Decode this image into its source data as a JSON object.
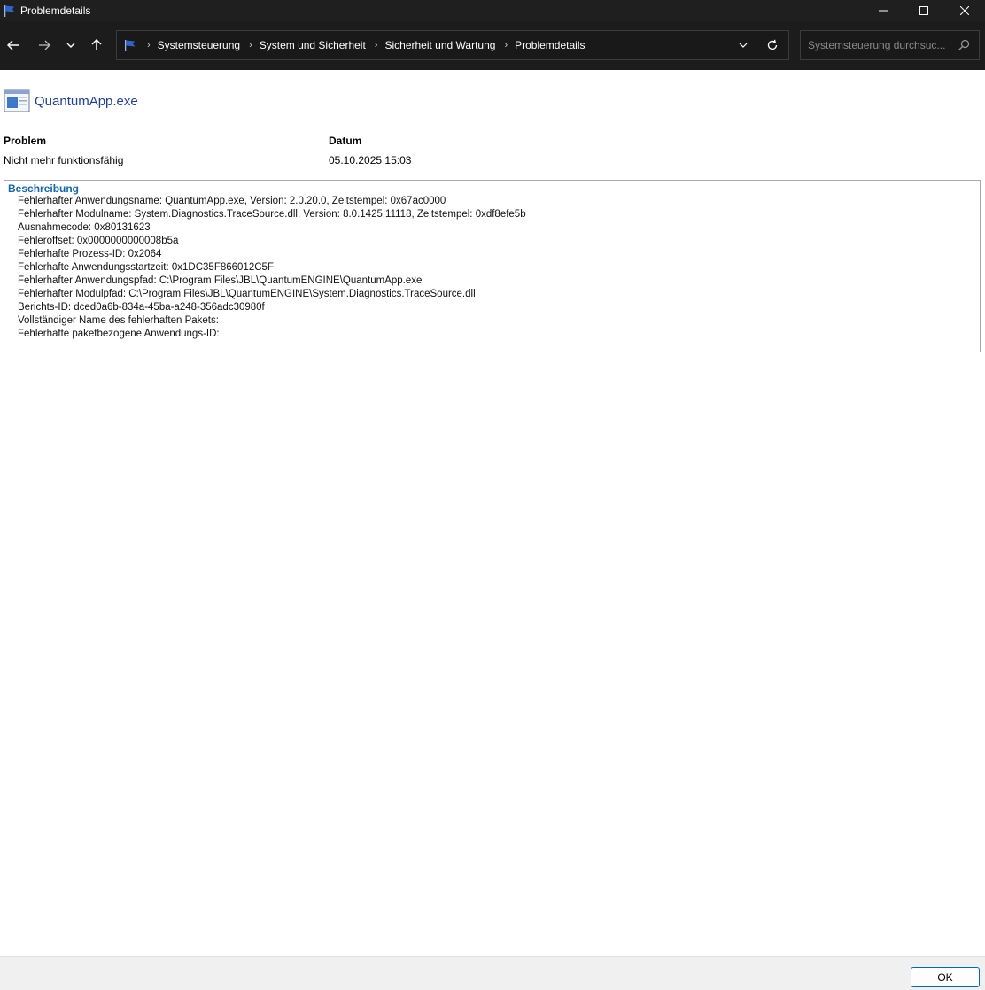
{
  "window": {
    "title": "Problemdetails"
  },
  "nav": {
    "breadcrumbs": [
      {
        "label": "Systemsteuerung"
      },
      {
        "label": "System und Sicherheit"
      },
      {
        "label": "Sicherheit und Wartung"
      },
      {
        "label": "Problemdetails"
      }
    ],
    "separator": "›",
    "search_placeholder": "Systemsteuerung durchsuc..."
  },
  "app": {
    "name": "QuantumApp.exe"
  },
  "summary": {
    "problem_header": "Problem",
    "problem_value": "Nicht mehr funktionsfähig",
    "date_header": "Datum",
    "date_value": "05.10.2025 15:03"
  },
  "description": {
    "title": "Beschreibung",
    "lines": [
      "Fehlerhafter Anwendungsname: QuantumApp.exe, Version: 2.0.20.0, Zeitstempel: 0x67ac0000",
      "Fehlerhafter Modulname: System.Diagnostics.TraceSource.dll, Version: 8.0.1425.11118, Zeitstempel: 0xdf8efe5b",
      "Ausnahmecode: 0x80131623",
      "Fehleroffset: 0x0000000000008b5a",
      "Fehlerhafte Prozess-ID: 0x2064",
      "Fehlerhafte Anwendungsstartzeit: 0x1DC35F866012C5F",
      "Fehlerhafter Anwendungspfad: C:\\Program Files\\JBL\\QuantumENGINE\\QuantumApp.exe",
      "Fehlerhafter Modulpfad: C:\\Program Files\\JBL\\QuantumENGINE\\System.Diagnostics.TraceSource.dll",
      "Berichts-ID: dced0a6b-834a-45ba-a248-356adc30980f",
      "Vollständiger Name des fehlerhaften Pakets:",
      "Fehlerhafte paketbezogene Anwendungs-ID:"
    ]
  },
  "footer": {
    "ok_label": "OK"
  },
  "icons": {
    "window_icon": "flag-icon",
    "back": "arrow-left-icon",
    "forward": "arrow-right-icon",
    "recent": "chevron-down-icon",
    "up": "arrow-up-icon",
    "refresh": "refresh-icon",
    "search": "search-icon",
    "app": "application-window-icon"
  },
  "colors": {
    "titlebar_bg": "#1f1f1f",
    "navbar_bg": "#1c1c1c",
    "link_blue": "#1f3f8f",
    "section_title_blue": "#1466a8",
    "ok_border": "#0067c0"
  }
}
